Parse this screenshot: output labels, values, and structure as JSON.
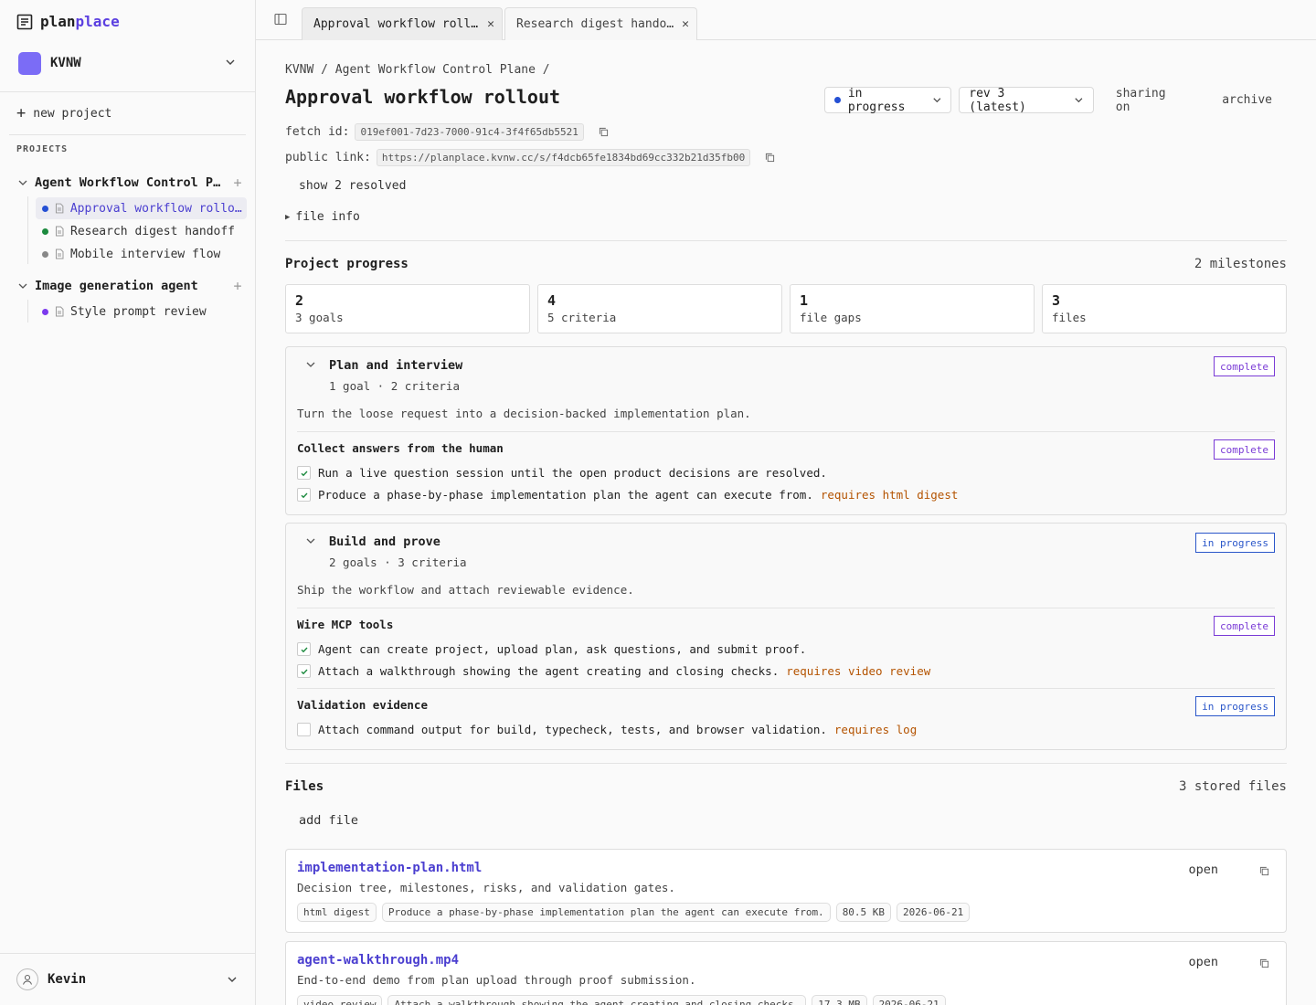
{
  "brand": {
    "part1": "plan",
    "part2": "place"
  },
  "org": {
    "name": "KVNW"
  },
  "sidebar": {
    "new_project": "new project",
    "projects_label": "PROJECTS",
    "groups": [
      {
        "name": "Agent Workflow Control Plane",
        "docs": [
          {
            "label": "Approval workflow rollout",
            "dot": "#2550d4"
          },
          {
            "label": "Research digest handoff",
            "dot": "#1c8a3e"
          },
          {
            "label": "Mobile interview flow",
            "dot": "#888888"
          }
        ]
      },
      {
        "name": "Image generation agent",
        "docs": [
          {
            "label": "Style prompt review",
            "dot": "#7c3aed"
          }
        ]
      }
    ],
    "user": "Kevin"
  },
  "tabs": [
    {
      "label": "Approval workflow rollout"
    },
    {
      "label": "Research digest handoff"
    }
  ],
  "page": {
    "breadcrumb": "KVNW / Agent Workflow Control Plane /",
    "title": "Approval workflow rollout",
    "status": "in progress",
    "revision": "rev 3 (latest)",
    "sharing": "sharing on",
    "archive": "archive",
    "fetch_label": "fetch id:",
    "fetch_id": "019ef001-7d23-7000-91c4-3f4f65db5521",
    "public_label": "public link:",
    "public_link": "https://planplace.kvnw.cc/s/f4dcb65fe1834bd69cc332b21d35fb00",
    "show_resolved": "show 2 resolved",
    "file_info": "file info"
  },
  "progress": {
    "title": "Project progress",
    "meta": "2 milestones",
    "stats": [
      {
        "value": "2",
        "label": "3 goals"
      },
      {
        "value": "4",
        "label": "5 criteria"
      },
      {
        "value": "1",
        "label": "file gaps"
      },
      {
        "value": "3",
        "label": "files"
      }
    ]
  },
  "milestones": [
    {
      "title": "Plan and interview",
      "meta": "1 goal · 2 criteria",
      "status": "complete",
      "desc": "Turn the loose request into a decision-backed implementation plan.",
      "goals": [
        {
          "title": "Collect answers from the human",
          "status": "complete",
          "criteria": [
            {
              "text": "Run a live question session until the open product decisions are resolved.",
              "req": ""
            },
            {
              "text": "Produce a phase-by-phase implementation plan the agent can execute from.",
              "req": "requires html digest"
            }
          ]
        }
      ]
    },
    {
      "title": "Build and prove",
      "meta": "2 goals · 3 criteria",
      "status": "in progress",
      "desc": "Ship the workflow and attach reviewable evidence.",
      "goals": [
        {
          "title": "Wire MCP tools",
          "status": "complete",
          "criteria": [
            {
              "text": "Agent can create project, upload plan, ask questions, and submit proof.",
              "req": ""
            },
            {
              "text": "Attach a walkthrough showing the agent creating and closing checks.",
              "req": "requires video review"
            }
          ]
        },
        {
          "title": "Validation evidence",
          "status": "in progress",
          "criteria": [
            {
              "text": "Attach command output for build, typecheck, tests, and browser validation.",
              "req": "requires log"
            }
          ]
        }
      ]
    }
  ],
  "files": {
    "title": "Files",
    "meta": "3 stored files",
    "add": "add file",
    "open_label": "open",
    "items": [
      {
        "name": "implementation-plan.html",
        "desc": "Decision tree, milestones, risks, and validation gates.",
        "chips": [
          "html digest",
          "Produce a phase-by-phase implementation plan the agent can execute from.",
          "80.5 KB",
          "2026-06-21"
        ]
      },
      {
        "name": "agent-walkthrough.mp4",
        "desc": "End-to-end demo from plan upload through proof submission.",
        "chips": [
          "video review",
          "Attach a walkthrough showing the agent creating and closing checks.",
          "17.3 MB",
          "2026-06-21"
        ]
      }
    ]
  }
}
